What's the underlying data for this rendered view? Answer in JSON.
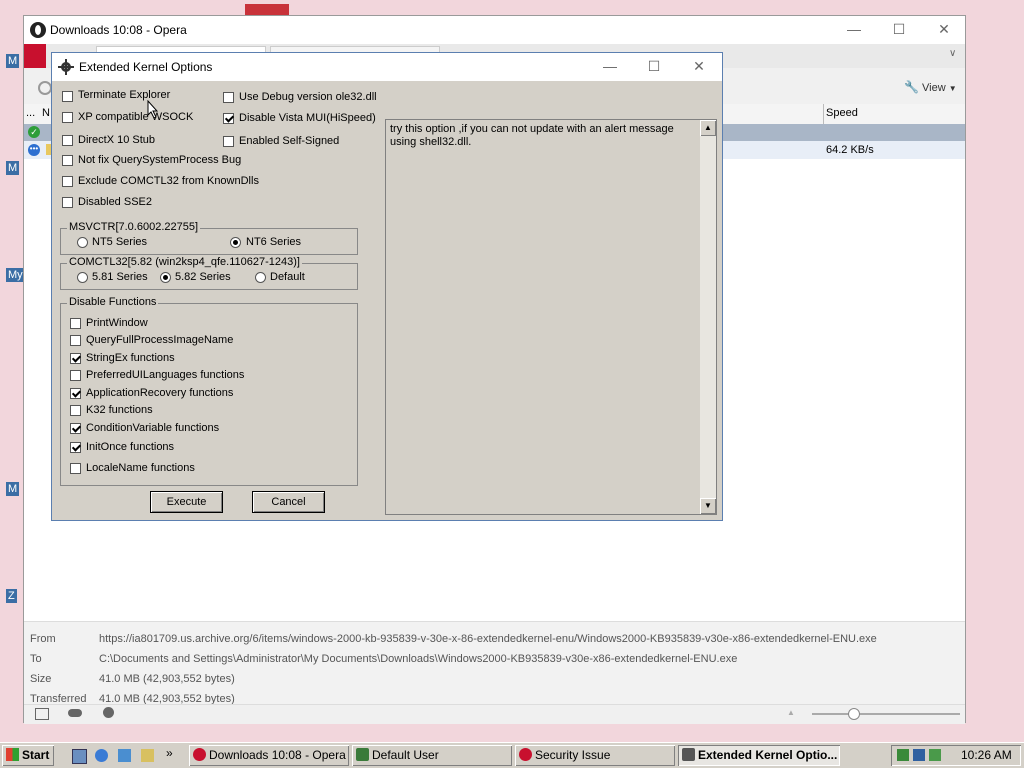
{
  "desktop": {
    "labels": [
      "M",
      "M",
      "My",
      "M",
      "Z"
    ]
  },
  "opera": {
    "title": "Downloads 10:08 - Opera",
    "view_label": "View",
    "columns": {
      "dots": "...",
      "n": "N",
      "speed": "Speed"
    },
    "rows": [
      {
        "speed": ""
      },
      {
        "speed": "64.2 KB/s"
      }
    ],
    "details": {
      "from_label": "From",
      "from_value": "https://ia801709.us.archive.org/6/items/windows-2000-kb-935839-v-30e-x-86-extendedkernel-enu/Windows2000-KB935839-v30e-x86-extendedkernel-ENU.exe",
      "to_label": "To",
      "to_value": "C:\\Documents and Settings\\Administrator\\My Documents\\Downloads\\Windows2000-KB935839-v30e-x86-extendedkernel-ENU.exe",
      "size_label": "Size",
      "size_value": "41.0 MB (42,903,552 bytes)",
      "transferred_label": "Transferred",
      "transferred_value": "41.0 MB (42,903,552 bytes)"
    }
  },
  "dialog": {
    "title": "Extended Kernel Options",
    "left_options": [
      {
        "label": "Terminate Explorer",
        "checked": false
      },
      {
        "label": "XP compatible WSOCK",
        "checked": false
      },
      {
        "label": "DirectX 10 Stub",
        "checked": false
      },
      {
        "label": "Not fix QuerySystemProcess Bug",
        "checked": false
      },
      {
        "label": "Exclude COMCTL32 from KnownDlls",
        "checked": false
      },
      {
        "label": "Disabled SSE2",
        "checked": false
      }
    ],
    "right_options": [
      {
        "label": "Use Debug version ole32.dll",
        "checked": false
      },
      {
        "label": "Disable Vista MUI(HiSpeed)",
        "checked": true
      },
      {
        "label": "Enabled Self-Signed",
        "checked": false
      }
    ],
    "msvcrt": {
      "title": "MSVCTR[7.0.6002.22755]",
      "options": [
        {
          "label": "NT5 Series",
          "selected": false
        },
        {
          "label": "NT6 Series",
          "selected": true
        }
      ]
    },
    "comctl": {
      "title": "COMCTL32[5.82 (win2ksp4_qfe.110627-1243)]",
      "options": [
        {
          "label": "5.81 Series",
          "selected": false
        },
        {
          "label": "5.82 Series",
          "selected": true
        },
        {
          "label": "Default",
          "selected": false
        }
      ]
    },
    "disable_functions": {
      "title": "Disable Functions",
      "items": [
        {
          "label": "PrintWindow",
          "checked": false
        },
        {
          "label": "QueryFullProcessImageName",
          "checked": false
        },
        {
          "label": "StringEx functions",
          "checked": true
        },
        {
          "label": "PreferredUILanguages functions",
          "checked": false
        },
        {
          "label": "ApplicationRecovery functions",
          "checked": true
        },
        {
          "label": "K32 functions",
          "checked": false
        },
        {
          "label": "ConditionVariable functions",
          "checked": true
        },
        {
          "label": "InitOnce functions",
          "checked": true
        },
        {
          "label": "LocaleName functions",
          "checked": false
        }
      ]
    },
    "execute_label": "Execute",
    "cancel_label": "Cancel",
    "help_text": "try this option ,if you can not update with an alert message using shell32.dll."
  },
  "taskbar": {
    "start_label": "Start",
    "tasks": [
      {
        "label": "Downloads 10:08 - Opera",
        "active": false,
        "icon_color": "#c8102e"
      },
      {
        "label": "Default User",
        "active": false,
        "icon_color": "#3a7a3a"
      },
      {
        "label": "Security Issue",
        "active": false,
        "icon_color": "#c8102e"
      },
      {
        "label": "Extended Kernel Optio...",
        "active": true,
        "icon_color": "#555555"
      }
    ],
    "clock": "10:26 AM"
  }
}
